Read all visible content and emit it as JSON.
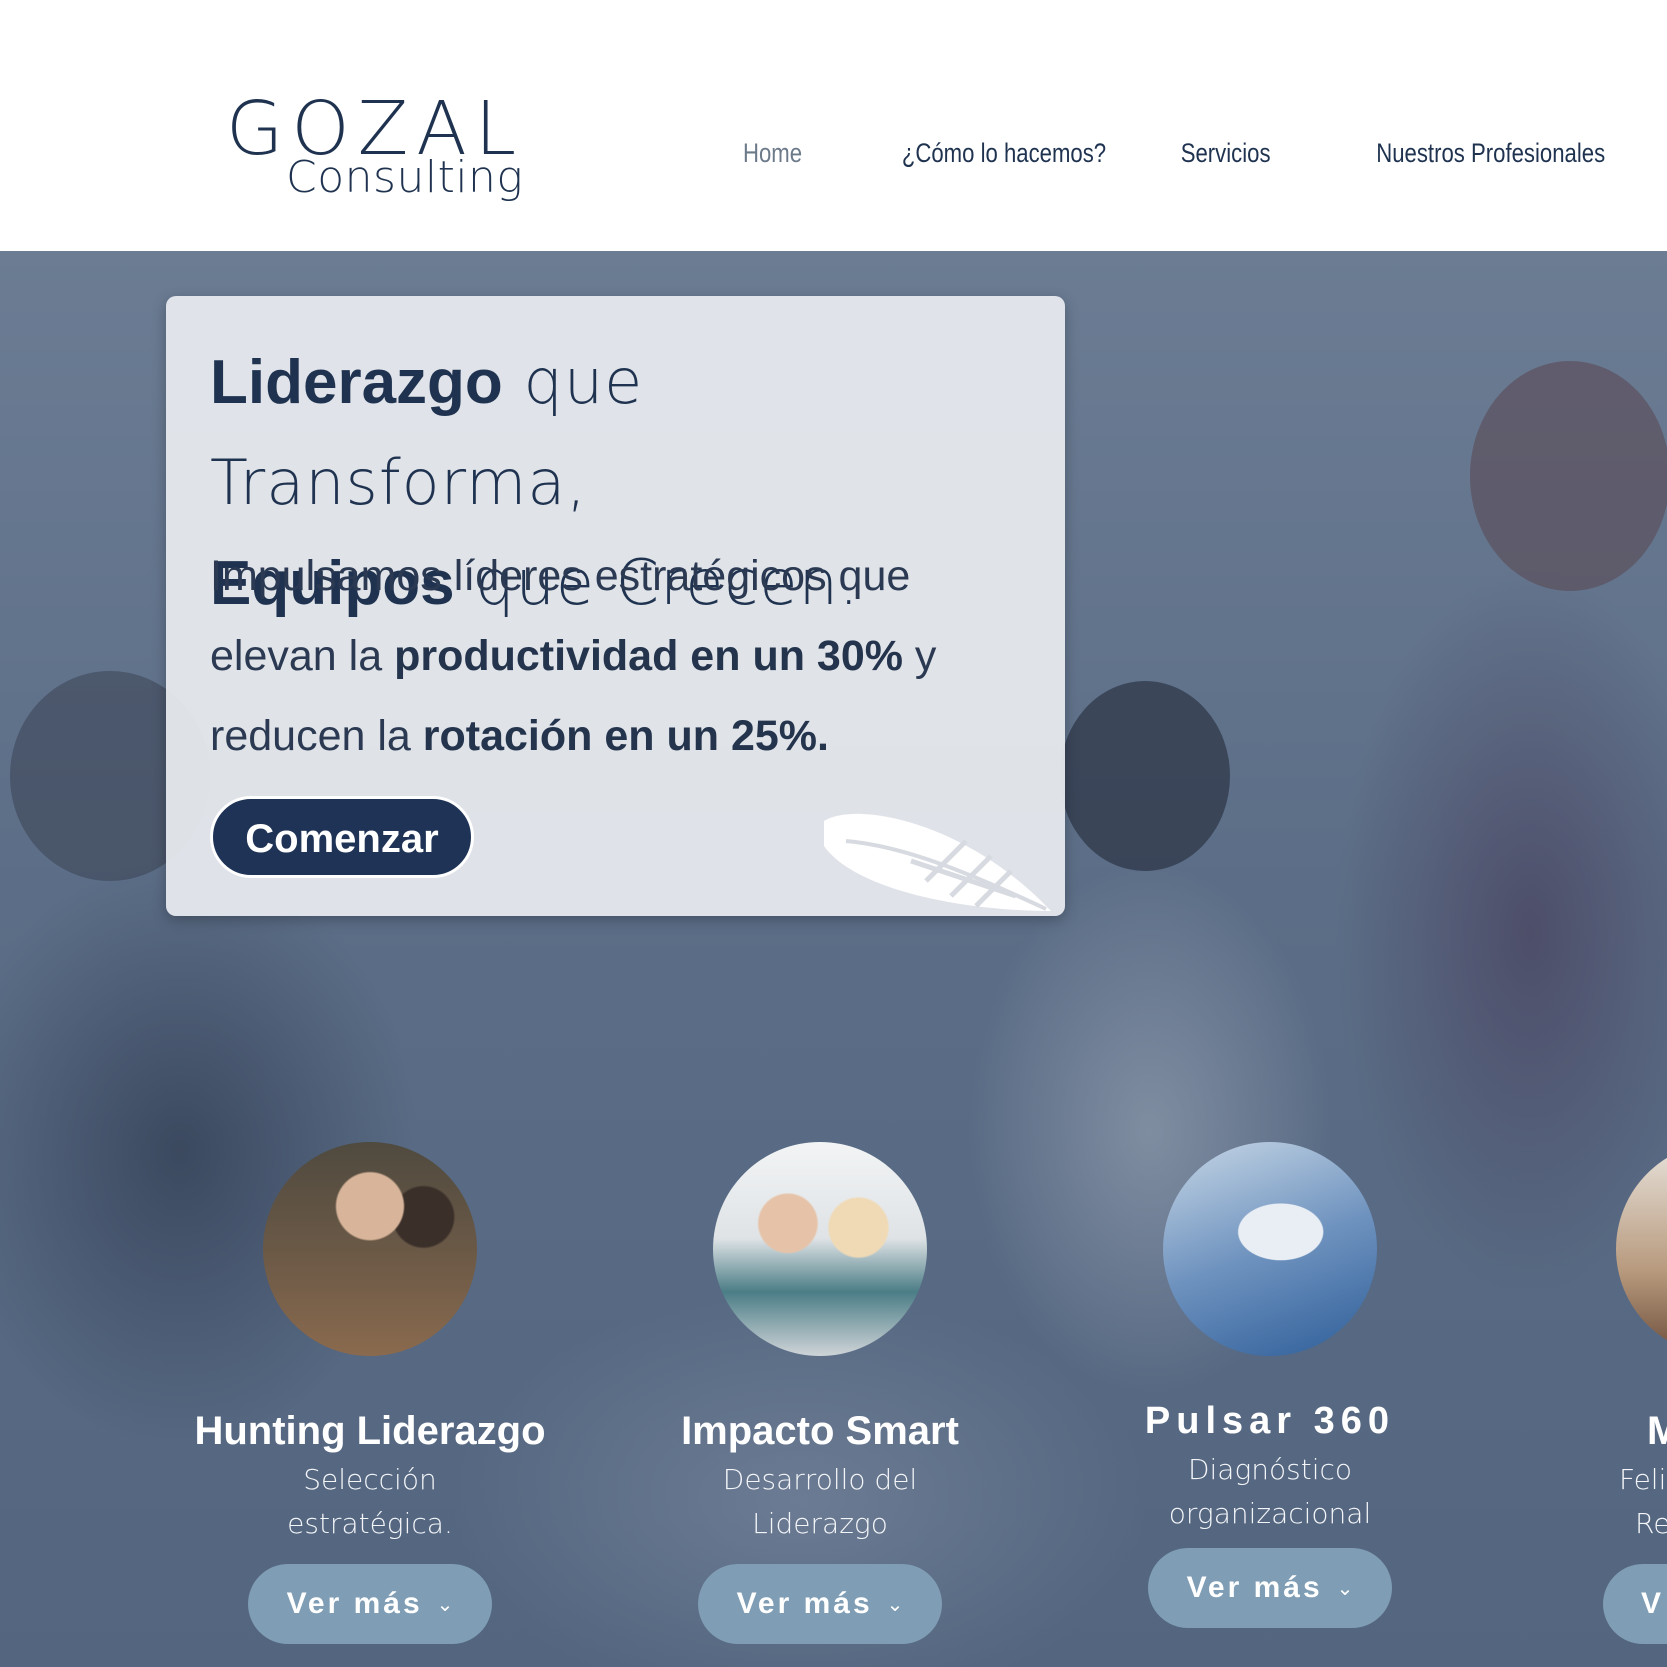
{
  "brand": {
    "logo_word": "GOZAL",
    "logo_sub": "Consulting"
  },
  "nav": {
    "items": [
      {
        "label": "Home",
        "active": true
      },
      {
        "label": "¿Cómo lo hacemos?",
        "active": false
      },
      {
        "label": "Servicios",
        "active": false
      },
      {
        "label": "Nuestros Profesionales",
        "active": false
      }
    ]
  },
  "hero": {
    "headline_line1_bold": "Liderazgo",
    "headline_line1_rest": " que Transforma,",
    "headline_line2_bold": "Equipos",
    "headline_line2_rest": " que Crecen.",
    "sub_part1": "Impulsamos líderes estratégicos que elevan la ",
    "sub_bold1": "productividad en un 30%",
    "sub_part2": " y reducen la ",
    "sub_bold2": "rotación en un 25%.",
    "cta_label": "Comenzar"
  },
  "services": [
    {
      "title": "Hunting Liderazgo",
      "desc_line1": "Selección",
      "desc_line2": "estratégica.",
      "button": "Ver más"
    },
    {
      "title": "Impacto Smart",
      "desc_line1": "Desarrollo del",
      "desc_line2": "Liderazgo",
      "button": "Ver más"
    },
    {
      "title": "Pulsar 360",
      "desc_line1": "Diagnóstico",
      "desc_line2": "organizacional",
      "button": "Ver más"
    },
    {
      "title": "M",
      "desc_line1": "Feli",
      "desc_line2": "Re",
      "button": "V"
    }
  ],
  "colors": {
    "navy": "#1f3350",
    "button_blue": "#7f9db4",
    "hero_overlay": "#5c6e87"
  }
}
